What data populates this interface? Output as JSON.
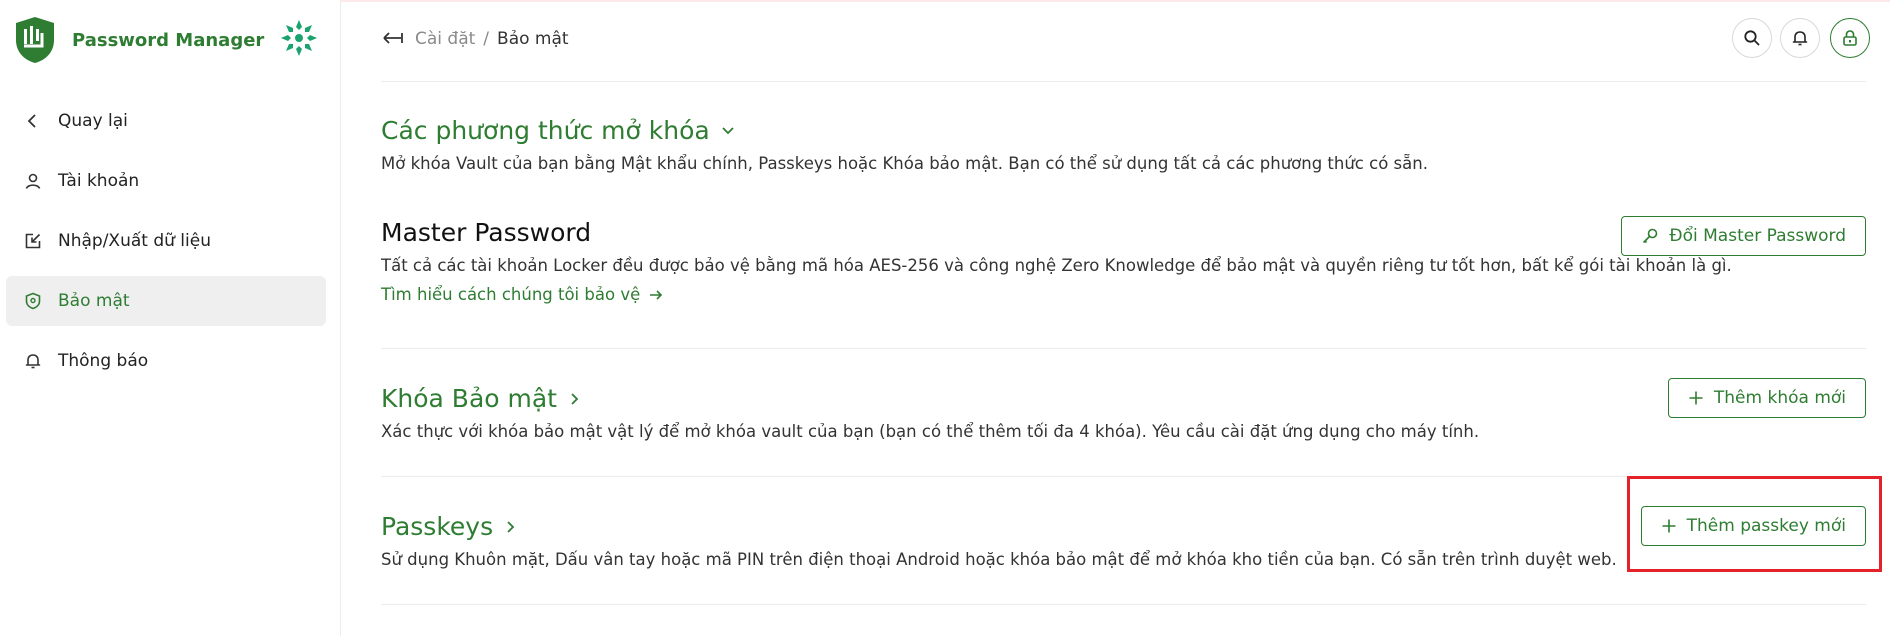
{
  "app": {
    "name": "Password Manager"
  },
  "sidebar": {
    "items": [
      {
        "label": "Quay lại",
        "icon": "chevron-left-icon"
      },
      {
        "label": "Tài khoản",
        "icon": "user-icon"
      },
      {
        "label": "Nhập/Xuất dữ liệu",
        "icon": "import-export-icon"
      },
      {
        "label": "Bảo mật",
        "icon": "shield-icon",
        "active": true
      },
      {
        "label": "Thông báo",
        "icon": "bell-icon"
      }
    ]
  },
  "header": {
    "breadcrumb": [
      "Cài đặt",
      "/",
      "Bảo mật"
    ],
    "actions": [
      "search-icon",
      "bell-icon",
      "lock-icon"
    ]
  },
  "sections": {
    "unlock_methods": {
      "title": "Các phương thức mở khóa",
      "description": "Mở khóa Vault của bạn bằng Mật khẩu chính, Passkeys hoặc Khóa bảo mật. Bạn có thể sử dụng tất cả các phương thức có sẵn."
    },
    "master_password": {
      "title": "Master Password",
      "description": "Tất cả các tài khoản Locker đều được bảo vệ bằng mã hóa AES-256 và công nghệ Zero Knowledge để bảo mật và quyền riêng tư tốt hơn, bất kể gói tài khoản là gì.",
      "link": "Tìm hiểu cách chúng tôi bảo vệ",
      "button": "Đổi Master Password"
    },
    "security_key": {
      "title": "Khóa Bảo mật",
      "description": "Xác thực với khóa bảo mật vật lý để mở khóa vault của bạn (bạn có thể thêm tối đa 4 khóa). Yêu cầu cài đặt ứng dụng cho máy tính.",
      "button": "Thêm khóa mới"
    },
    "passkeys": {
      "title": "Passkeys",
      "description": "Sử dụng Khuôn mặt, Dấu vân tay hoặc mã PIN trên điện thoại Android hoặc khóa bảo mật để mở khóa kho tiền của bạn. Có sẵn trên trình duyệt web.",
      "button": "Thêm passkey mới"
    }
  },
  "colors": {
    "accent": "#2e7d32",
    "highlight": "#e5222a",
    "active_bg": "#efefef"
  }
}
